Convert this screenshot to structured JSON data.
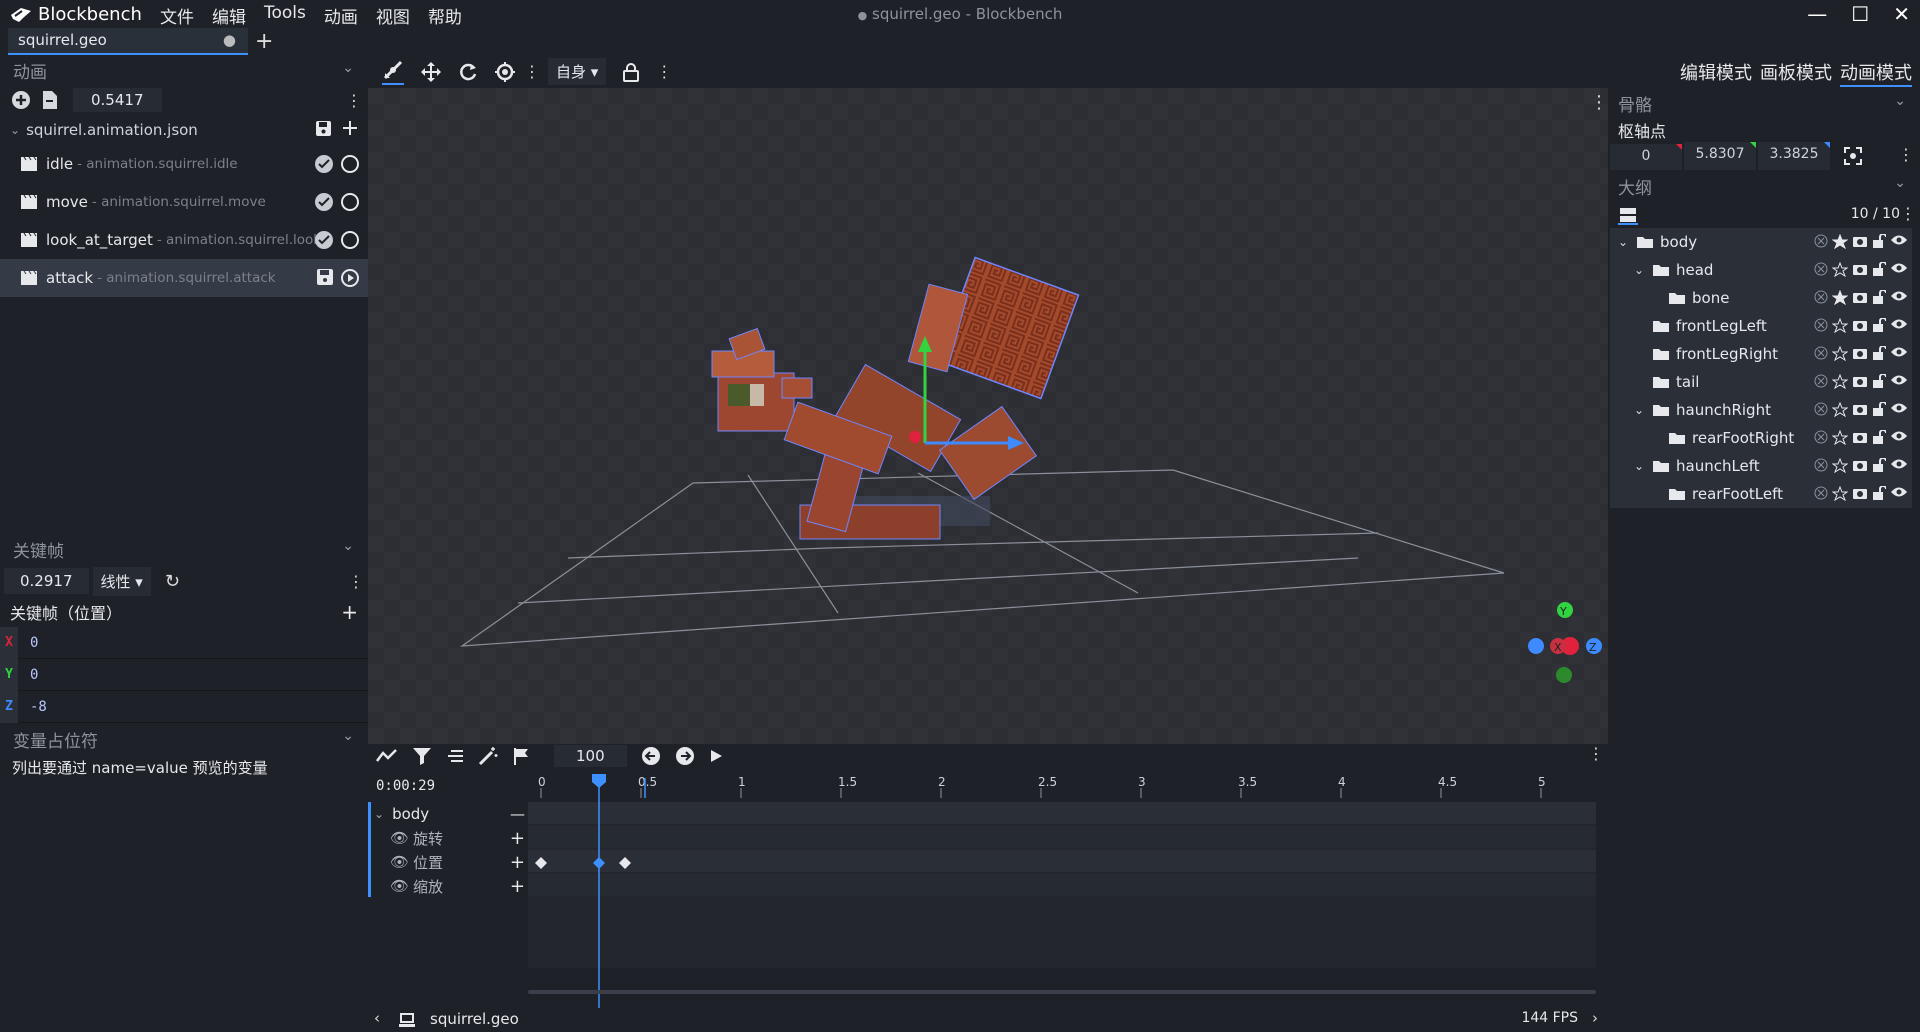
{
  "app": {
    "name": "Blockbench",
    "window_title": "squirrel.geo - Blockbench",
    "unsaved_dot": "●"
  },
  "menu": [
    "文件",
    "编辑",
    "Tools",
    "动画",
    "视图",
    "帮助"
  ],
  "tab": {
    "label": "squirrel.geo",
    "add": "+"
  },
  "modes": [
    "编辑模式",
    "画板模式",
    "动画模式"
  ],
  "animations_panel": {
    "title": "动画",
    "time_value": "0.5417",
    "file": "squirrel.animation.json",
    "items": [
      {
        "name": "idle",
        "id": " - animation.squirrel.idle"
      },
      {
        "name": "move",
        "id": " - animation.squirrel.move"
      },
      {
        "name": "look_at_target",
        "id": " - animation.squirrel.look_a"
      },
      {
        "name": "attack",
        "id": " - animation.squirrel.attack"
      }
    ]
  },
  "keyframe_panel": {
    "title": "关键帧",
    "time": "0.2917",
    "interpolation": "线性",
    "channel_label": "关键帧（位置）",
    "axes": [
      {
        "axis": "X",
        "value": "0",
        "color": "#e0223c"
      },
      {
        "axis": "Y",
        "value": "0",
        "color": "#31d43e"
      },
      {
        "axis": "Z",
        "value": "-8",
        "color": "#3d8bff"
      }
    ]
  },
  "variables_panel": {
    "title": "变量占位符",
    "hint": "列出要通过 name=value 预览的变量"
  },
  "toolbar": {
    "space": "自身"
  },
  "bones_panel": {
    "title": "骨骼",
    "pivot_label": "枢轴点",
    "pivot": [
      "0",
      "5.8307",
      "3.3825"
    ]
  },
  "outliner": {
    "title": "大纲",
    "count": "10 / 10",
    "items": [
      {
        "name": "body",
        "depth": 0,
        "expanded": true
      },
      {
        "name": "head",
        "depth": 1,
        "expanded": true
      },
      {
        "name": "bone",
        "depth": 2,
        "expanded": false
      },
      {
        "name": "frontLegLeft",
        "depth": 1,
        "expanded": false
      },
      {
        "name": "frontLegRight",
        "depth": 1,
        "expanded": false
      },
      {
        "name": "tail",
        "depth": 1,
        "expanded": false
      },
      {
        "name": "haunchRight",
        "depth": 1,
        "expanded": true
      },
      {
        "name": "rearFootRight",
        "depth": 2,
        "expanded": false
      },
      {
        "name": "haunchLeft",
        "depth": 1,
        "expanded": true
      },
      {
        "name": "rearFootLeft",
        "depth": 2,
        "expanded": false
      }
    ]
  },
  "timeline": {
    "zoom_value": "100",
    "timecode": "0:00:29",
    "ticks": [
      "0",
      "0.5",
      "1",
      "1.5",
      "2",
      "2.5",
      "3",
      "3.5",
      "4",
      "4.5",
      "5"
    ],
    "playhead_time": 0.29,
    "group": "body",
    "channels": [
      "旋转",
      "位置",
      "缩放"
    ],
    "position_keyframes": [
      0,
      0.29,
      0.42
    ]
  },
  "status": {
    "file": "squirrel.geo",
    "fps": "144 FPS"
  },
  "gizmo": {
    "y": "Y",
    "x": "X",
    "z": "Z"
  },
  "colors": {
    "accent": "#3e90ff",
    "x": "#e0223c",
    "y": "#31d43e",
    "z": "#3d8bff"
  }
}
